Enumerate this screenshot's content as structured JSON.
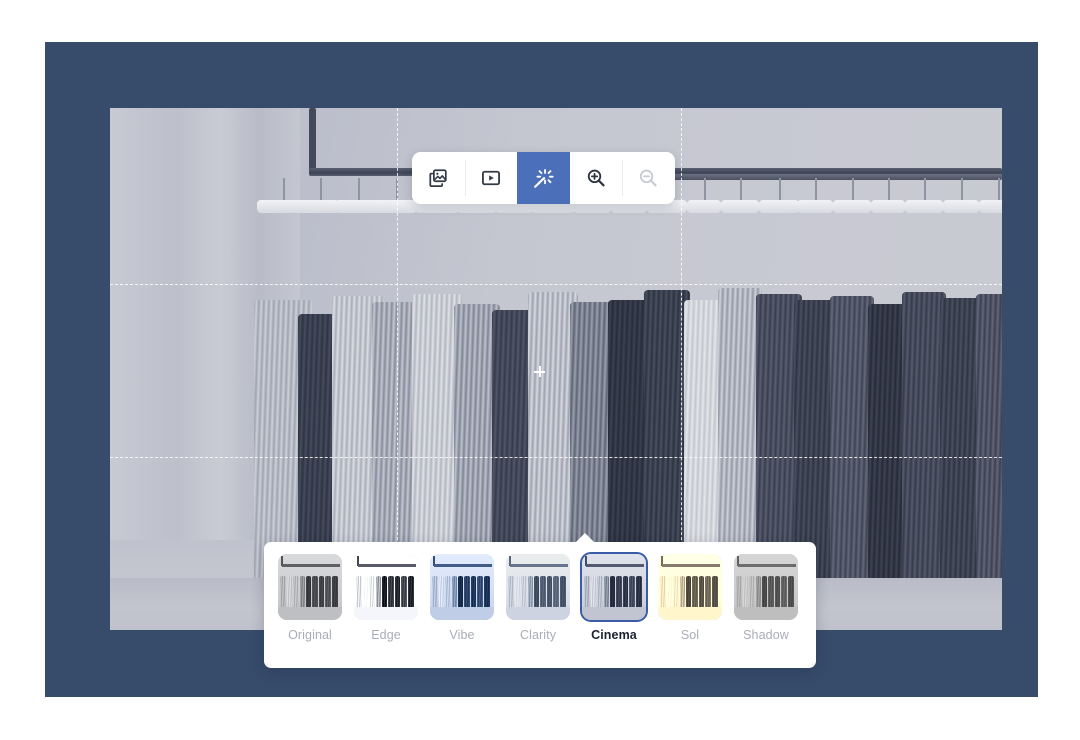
{
  "app": {
    "frame_color": "#374b6b",
    "accent_color": "#4b70b9",
    "selected_border_color": "#3a5ca8"
  },
  "toolbar": {
    "name": "editor-toolbar",
    "buttons": [
      {
        "id": "media-library",
        "icon": "photo-stack-icon",
        "label": "Media",
        "active": false,
        "disabled": false
      },
      {
        "id": "video",
        "icon": "video-play-icon",
        "label": "Video",
        "active": false,
        "disabled": false
      },
      {
        "id": "effects",
        "icon": "magic-wand-icon",
        "label": "Effects",
        "active": true,
        "disabled": false
      },
      {
        "id": "zoom-in",
        "icon": "zoom-in-icon",
        "label": "Zoom In",
        "active": false,
        "disabled": false
      },
      {
        "id": "zoom-out",
        "icon": "zoom-out-icon",
        "label": "Zoom Out",
        "active": false,
        "disabled": true
      }
    ]
  },
  "canvas": {
    "name": "photo-canvas",
    "subject": "clothing rack with pleated garments",
    "guides_visible": true,
    "center_marker_icon": "crosshair-icon"
  },
  "filter_panel": {
    "name": "filter-picker",
    "selected": "Cinema",
    "filters": [
      {
        "label": "Original",
        "tone": "neutral-gray",
        "class": "f-original"
      },
      {
        "label": "Edge",
        "tone": "high-contrast",
        "class": "f-edge"
      },
      {
        "label": "Vibe",
        "tone": "deep-blue",
        "class": "f-vibe"
      },
      {
        "label": "Clarity",
        "tone": "light-blue",
        "class": "f-clarity"
      },
      {
        "label": "Cinema",
        "tone": "blue-gray",
        "class": "f-cinema"
      },
      {
        "label": "Sol",
        "tone": "warm-cream",
        "class": "f-sol"
      },
      {
        "label": "Shadow",
        "tone": "flat-gray",
        "class": "f-shadow"
      }
    ]
  }
}
